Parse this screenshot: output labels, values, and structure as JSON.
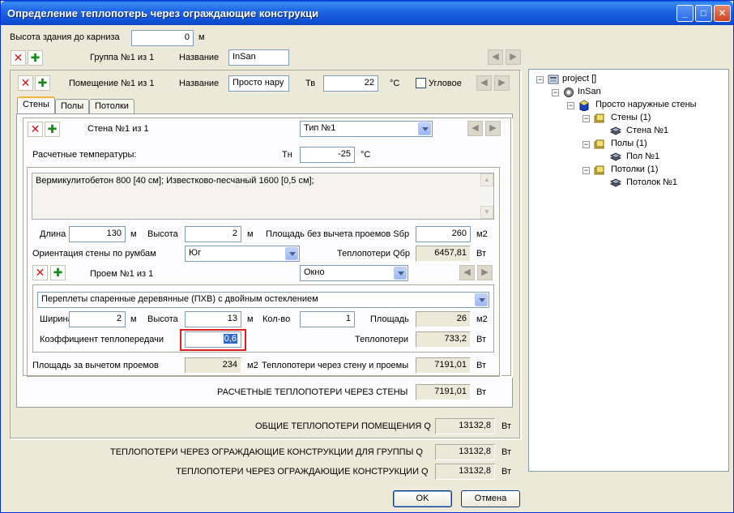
{
  "window": {
    "title": "Определение теплопотерь через ограждающие конструкци",
    "buttons": {
      "minimize": "_",
      "maximize": "□",
      "close": "✕"
    }
  },
  "building": {
    "height_label": "Высота здания до карниза",
    "height_value": "0",
    "height_unit": "м"
  },
  "group": {
    "counter": "Группа №1 из 1",
    "name_label": "Название",
    "name_value": "InSan"
  },
  "room": {
    "counter": "Помещение №1 из 1",
    "name_label": "Название",
    "name_value": "Просто нару",
    "tv_label": "Тв",
    "tv_value": "22",
    "tv_unit": "°C",
    "corner_label": "Угловое"
  },
  "tabs": [
    "Стены",
    "Полы",
    "Потолки"
  ],
  "wall": {
    "counter": "Стена №1 из 1",
    "type_value": "Тип №1",
    "calc_temps_label": "Расчетные температуры:",
    "tn_label": "Тн",
    "tn_value": "-25",
    "tn_unit": "°C",
    "materials": "Вермикулитобетон 800 [40 см]; Известково-песчаный 1600 [0,5 см];",
    "length_label": "Длина",
    "length_value": "130",
    "length_unit": "м",
    "height_label": "Высота",
    "height_value": "2",
    "height_unit": "м",
    "area_gross_label": "Площадь без вычета проемов Sбр",
    "area_gross_value": "260",
    "area_gross_unit": "м2",
    "orientation_label": "Ориентация стены по румбам",
    "orientation_value": "Юг",
    "heatloss_gross_label": "Теплопотери Qбр",
    "heatloss_gross_value": "6457,81",
    "heatloss_gross_unit": "Вт",
    "net_area_label": "Площадь за вычетом проемов",
    "net_area_value": "234",
    "net_area_unit": "м2",
    "wall_openings_loss_label": "Теплопотери через стену и проемы",
    "wall_openings_loss_value": "7191,01",
    "wall_openings_loss_unit": "Вт",
    "total_walls_label": "РАСЧЕТНЫЕ ТЕПЛОПОТЕРИ ЧЕРЕЗ СТЕНЫ",
    "total_walls_value": "7191,01",
    "total_walls_unit": "Вт"
  },
  "opening": {
    "counter": "Проем №1 из 1",
    "type_value": "Окно",
    "construction": "Переплеты спаренные деревянные (ПХВ) с двойным остеклением",
    "width_label": "Ширина",
    "width_value": "2",
    "width_unit": "м",
    "height_label": "Высота",
    "height_value": "13",
    "height_unit": "м",
    "count_label": "Кол-во",
    "count_value": "1",
    "area_label": "Площадь",
    "area_value": "26",
    "area_unit": "м2",
    "coef_label": "Коэффициент теплопередачи",
    "coef_value": "0,6",
    "heatloss_label": "Теплопотери",
    "heatloss_value": "733,2",
    "heatloss_unit": "Вт"
  },
  "totals": {
    "room_label": "ОБЩИЕ ТЕПЛОПОТЕРИ ПОМЕЩЕНИЯ Q",
    "room_value": "13132,8",
    "room_unit": "Вт",
    "group_label": "ТЕПЛОПОТЕРИ  ЧЕРЕЗ ОГРАЖДАЮЩИЕ КОНСТРУКЦИИ ДЛЯ ГРУППЫ Q",
    "group_value": "13132,8",
    "group_unit": "Вт",
    "all_label": "ТЕПЛОПОТЕРИ ЧЕРЕЗ ОГРАЖДАЮЩИЕ КОНСТРУКЦИИ Q",
    "all_value": "13132,8",
    "all_unit": "Вт"
  },
  "dialog": {
    "ok": "OK",
    "cancel": "Отмена"
  },
  "tree": {
    "project": "project []",
    "group": "InSan",
    "room": "Просто наружные стены",
    "walls": "Стены (1)",
    "wall1": "Стена №1",
    "floors": "Полы (1)",
    "floor1": "Пол №1",
    "ceilings": "Потолки (1)",
    "ceiling1": "Потолок №1"
  }
}
